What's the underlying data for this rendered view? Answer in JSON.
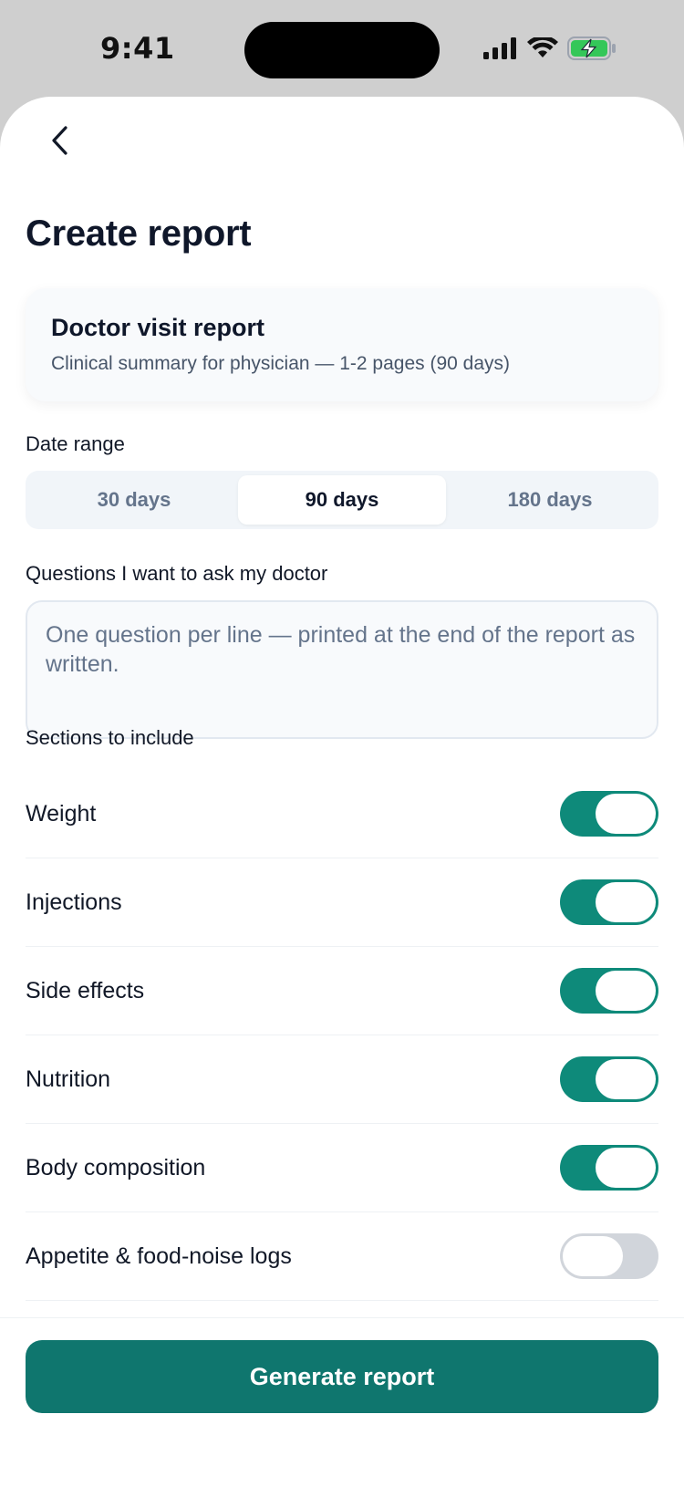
{
  "status_bar": {
    "time": "9:41",
    "icons": [
      "signal-icon",
      "wifi-icon",
      "battery-charging-icon"
    ],
    "battery_color": "#34c759"
  },
  "header": {
    "back_icon": "chevron-left-icon",
    "title": "Create report"
  },
  "report_card": {
    "title": "Doctor visit report",
    "subtitle": "Clinical summary for physician — 1-2 pages (90 days)"
  },
  "date_range": {
    "label": "Date range",
    "options": [
      "30 days",
      "90 days",
      "180 days"
    ],
    "selected": "90 days"
  },
  "questions": {
    "label": "Questions I want to ask my doctor",
    "value": "",
    "placeholder": "One question per line — printed at the end of the report as written."
  },
  "sections": {
    "label": "Sections to include",
    "items": [
      {
        "label": "Weight",
        "enabled": true
      },
      {
        "label": "Injections",
        "enabled": true
      },
      {
        "label": "Side effects",
        "enabled": true
      },
      {
        "label": "Nutrition",
        "enabled": true
      },
      {
        "label": "Body composition",
        "enabled": true
      },
      {
        "label": "Appetite & food-noise logs",
        "enabled": false
      }
    ]
  },
  "footer": {
    "generate_label": "Generate report"
  },
  "colors": {
    "accent": "#0f766e",
    "toggle_on": "#0e8a7a",
    "toggle_off": "#d1d5db"
  }
}
